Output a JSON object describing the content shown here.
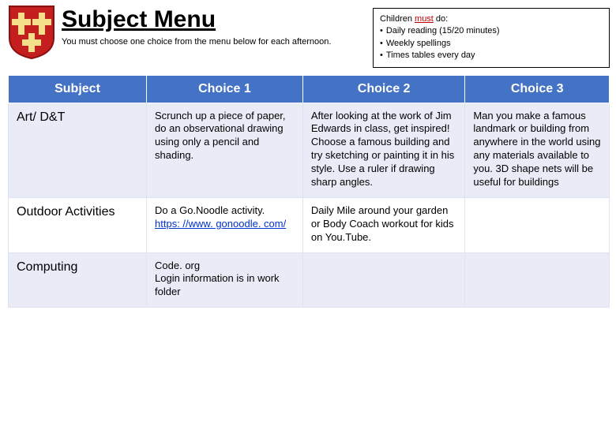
{
  "header": {
    "title": "Subject Menu",
    "subtitle": "You must choose one choice from the menu below for each afternoon."
  },
  "must_box": {
    "intro_prefix": "Children ",
    "intro_must": "must",
    "intro_suffix": " do:",
    "bullets": [
      "Daily reading (15/20 minutes)",
      "Weekly spellings",
      "Times tables every day"
    ]
  },
  "table": {
    "headers": [
      "Subject",
      "Choice 1",
      "Choice 2",
      "Choice 3"
    ],
    "rows": [
      {
        "subject": "Art/ D&T",
        "choice1": "Scrunch up a piece of paper, do an observational drawing using only a pencil and shading.",
        "choice2": "After looking at the work of Jim Edwards in class, get inspired! Choose a famous building and try sketching or painting it in his style. Use a ruler if drawing sharp angles.",
        "choice3": "Man you make a famous landmark or building from anywhere in the world using any materials available to you. 3D shape nets will be useful for buildings"
      },
      {
        "subject": "Outdoor Activities",
        "choice1_pre": "Do a Go.Noodle activity.",
        "choice1_link_text": "https: //www. gonoodle. com/",
        "choice1_link_href": "https://www.gonoodle.com/",
        "choice2": "Daily Mile around your garden or Body Coach workout for kids on You.Tube.",
        "choice3": ""
      },
      {
        "subject": "Computing",
        "choice1": "Code. org\nLogin information is in work folder",
        "choice2": "",
        "choice3": ""
      }
    ]
  }
}
